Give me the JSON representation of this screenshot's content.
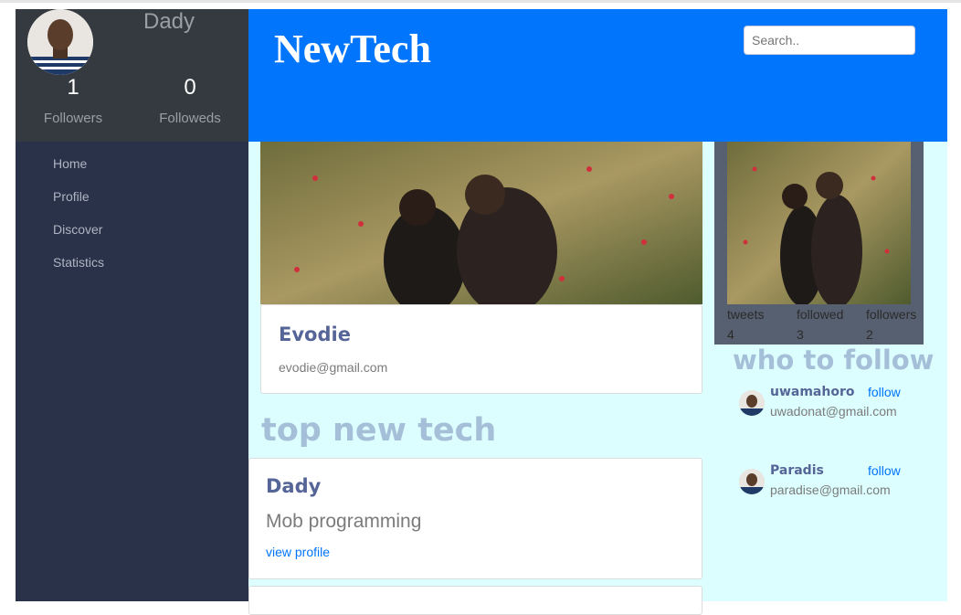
{
  "user": {
    "name": "Dady",
    "followers_count": "1",
    "followers_label": "Followers",
    "followeds_count": "0",
    "followeds_label": "Followeds"
  },
  "nav": {
    "items": [
      {
        "label": "Home"
      },
      {
        "label": "Profile"
      },
      {
        "label": "Discover"
      },
      {
        "label": "Statistics"
      }
    ]
  },
  "header": {
    "brand": "NewTech",
    "search_placeholder": "Search.."
  },
  "featured_card": {
    "name": "Evodie",
    "email": "evodie@gmail.com"
  },
  "top_section": {
    "title": "top new tech"
  },
  "tech_card": {
    "name": "Dady",
    "role": "Mob programming",
    "link": "view profile"
  },
  "profile_stats": [
    {
      "label": "tweets",
      "value": "4"
    },
    {
      "label": "followed",
      "value": "3"
    },
    {
      "label": "followers",
      "value": "2"
    }
  ],
  "who_to_follow": {
    "title": "who to follow",
    "users": [
      {
        "name": "uwamahoro",
        "follow": "follow",
        "email": "uwadonat@gmail.com"
      },
      {
        "name": "Paradis",
        "follow": "follow",
        "email": "paradise@gmail.com"
      }
    ]
  }
}
